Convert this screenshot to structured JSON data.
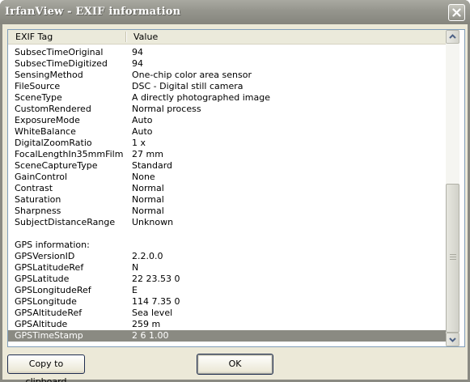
{
  "window": {
    "title": "IrfanView - EXIF information"
  },
  "list": {
    "columns": [
      "EXIF Tag",
      "Value"
    ],
    "rows": [
      [
        "SubsecTimeOriginal",
        "94"
      ],
      [
        "SubsecTimeDigitized",
        "94"
      ],
      [
        "SensingMethod",
        "One-chip color area sensor"
      ],
      [
        "FileSource",
        "DSC - Digital still camera"
      ],
      [
        "SceneType",
        "A directly photographed image"
      ],
      [
        "CustomRendered",
        "Normal process"
      ],
      [
        "ExposureMode",
        "Auto"
      ],
      [
        "WhiteBalance",
        "Auto"
      ],
      [
        "DigitalZoomRatio",
        "1 x"
      ],
      [
        "FocalLengthIn35mmFilm",
        "27 mm"
      ],
      [
        "SceneCaptureType",
        "Standard"
      ],
      [
        "GainControl",
        "None"
      ],
      [
        "Contrast",
        "Normal"
      ],
      [
        "Saturation",
        "Normal"
      ],
      [
        "Sharpness",
        "Normal"
      ],
      [
        "SubjectDistanceRange",
        "Unknown"
      ],
      [
        "",
        ""
      ],
      [
        "GPS information:",
        ""
      ],
      [
        "GPSVersionID",
        "2.2.0.0"
      ],
      [
        "GPSLatitudeRef",
        "N"
      ],
      [
        "GPSLatitude",
        "22  23.53  0"
      ],
      [
        "GPSLongitudeRef",
        "E"
      ],
      [
        "GPSLongitude",
        "114  7.35  0"
      ],
      [
        "GPSAltitudeRef",
        "Sea level"
      ],
      [
        "GPSAltitude",
        "259 m"
      ],
      [
        "GPSTimeStamp",
        "2  6  1.00"
      ]
    ],
    "selected_row_index": 25
  },
  "buttons": {
    "copy": "Copy to clipboard",
    "ok": "OK"
  },
  "icons": {
    "close": "close-icon",
    "scroll_up": "chevron-up-icon",
    "scroll_down": "chevron-down-icon",
    "thumb_grip": "grip-icon"
  },
  "colors": {
    "selection": "#8a8a82",
    "titlebar": "#95958d",
    "face": "#ece9d8"
  }
}
